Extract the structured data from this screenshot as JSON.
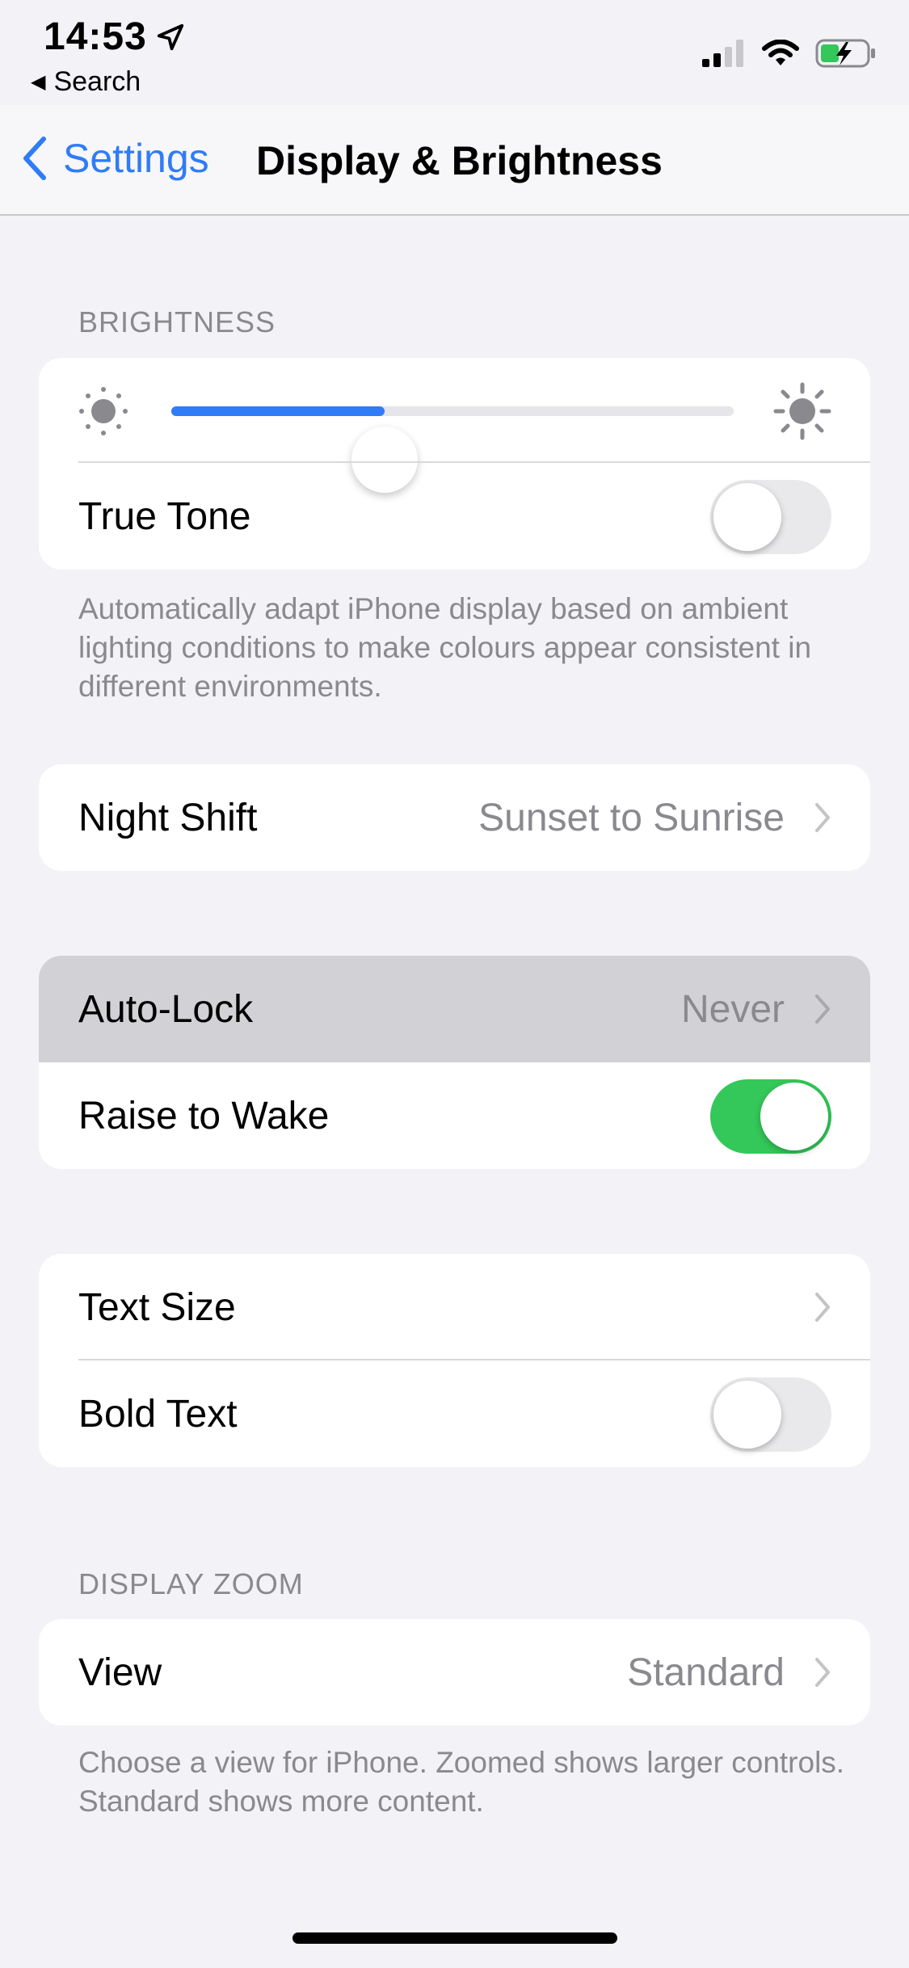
{
  "status_bar": {
    "time": "14:53",
    "back_app": "Search"
  },
  "nav": {
    "back_label": "Settings",
    "title": "Display & Brightness"
  },
  "brightness": {
    "header": "BRIGHTNESS",
    "level": 0.38,
    "true_tone_label": "True Tone",
    "true_tone_on": false,
    "footnote": "Automatically adapt iPhone display based on ambient lighting conditions to make colours appear consistent in different environments."
  },
  "night_shift": {
    "label": "Night Shift",
    "value": "Sunset to Sunrise"
  },
  "lock": {
    "auto_lock_label": "Auto-Lock",
    "auto_lock_value": "Never",
    "raise_label": "Raise to Wake",
    "raise_on": true
  },
  "text": {
    "size_label": "Text Size",
    "bold_label": "Bold Text",
    "bold_on": false
  },
  "zoom": {
    "header": "DISPLAY ZOOM",
    "view_label": "View",
    "view_value": "Standard",
    "footnote": "Choose a view for iPhone. Zoomed shows larger controls. Standard shows more content."
  },
  "colors": {
    "accent": "#2f7cf6",
    "toggle_on": "#34c759",
    "background": "#f2f2f7",
    "secondary_text": "#8a8a8e"
  },
  "icons": [
    "location-arrow-icon",
    "back-triangle-icon",
    "cellular-signal-icon",
    "wifi-icon",
    "battery-charging-icon",
    "chevron-left-icon",
    "sun-small-icon",
    "sun-large-icon",
    "chevron-right-icon"
  ]
}
